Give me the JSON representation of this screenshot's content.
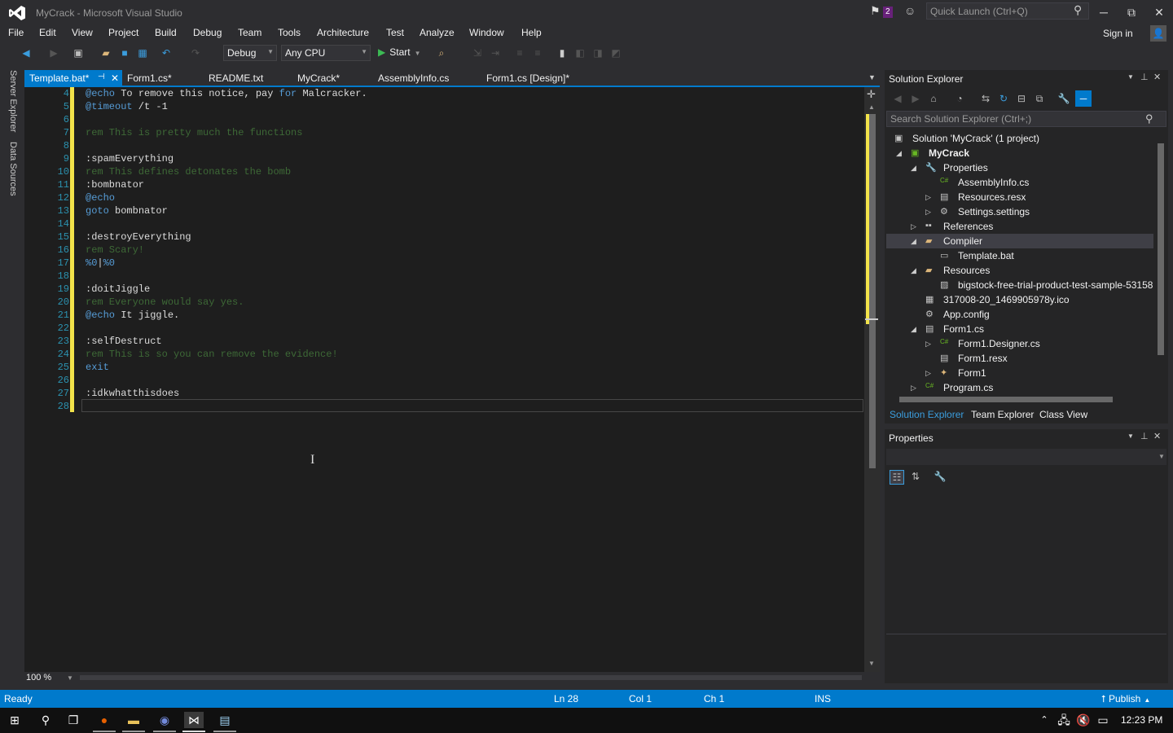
{
  "window": {
    "title": "MyCrack - Microsoft Visual Studio",
    "notification_count": "2",
    "quick_launch_placeholder": "Quick Launch (Ctrl+Q)",
    "minimize": "─",
    "restore": "⧉",
    "close": "✕"
  },
  "menu": [
    "File",
    "Edit",
    "View",
    "Project",
    "Build",
    "Debug",
    "Team",
    "Tools",
    "Architecture",
    "Test",
    "Analyze",
    "Window",
    "Help"
  ],
  "account": {
    "signin_label": "Sign in"
  },
  "toolbar": {
    "configuration": "Debug",
    "platform": "Any CPU",
    "start_label": "Start"
  },
  "left_strip": {
    "server_explorer": "Server Explorer",
    "data_sources": "Data Sources"
  },
  "tabs": [
    {
      "label": "Template.bat*",
      "active": true
    },
    {
      "label": "Form1.cs*"
    },
    {
      "label": "README.txt"
    },
    {
      "label": "MyCrack*"
    },
    {
      "label": "AssemblyInfo.cs"
    },
    {
      "label": "Form1.cs [Design]*"
    }
  ],
  "editor": {
    "lines": [
      {
        "n": "4",
        "parts": [
          [
            "kw",
            "@echo"
          ],
          [
            "t",
            " To remove this notice, pay "
          ],
          [
            "kw",
            "for"
          ],
          [
            "t",
            " Malcracker."
          ]
        ]
      },
      {
        "n": "5",
        "parts": [
          [
            "kw",
            "@timeout"
          ],
          [
            "t",
            " /t -1"
          ]
        ]
      },
      {
        "n": "6",
        "parts": []
      },
      {
        "n": "7",
        "parts": [
          [
            "cm",
            "rem This is pretty much the functions"
          ]
        ]
      },
      {
        "n": "8",
        "parts": []
      },
      {
        "n": "9",
        "parts": [
          [
            "t",
            ":spamEverything"
          ]
        ]
      },
      {
        "n": "10",
        "parts": [
          [
            "cm",
            "rem This defines detonates the bomb"
          ]
        ]
      },
      {
        "n": "11",
        "parts": [
          [
            "t",
            ":bombnator"
          ]
        ]
      },
      {
        "n": "12",
        "parts": [
          [
            "kw",
            "@echo"
          ]
        ]
      },
      {
        "n": "13",
        "parts": [
          [
            "kw",
            "goto"
          ],
          [
            "t",
            " bombnator"
          ]
        ]
      },
      {
        "n": "14",
        "parts": []
      },
      {
        "n": "15",
        "parts": [
          [
            "t",
            ":destroyEverything"
          ]
        ]
      },
      {
        "n": "16",
        "parts": [
          [
            "cm",
            "rem Scary!"
          ]
        ]
      },
      {
        "n": "17",
        "parts": [
          [
            "kw",
            "%0"
          ],
          [
            "t",
            "|"
          ],
          [
            "kw",
            "%0"
          ]
        ]
      },
      {
        "n": "18",
        "parts": []
      },
      {
        "n": "19",
        "parts": [
          [
            "t",
            ":doitJiggle"
          ]
        ]
      },
      {
        "n": "20",
        "parts": [
          [
            "cm",
            "rem Everyone would say yes."
          ]
        ]
      },
      {
        "n": "21",
        "parts": [
          [
            "kw",
            "@echo"
          ],
          [
            "t",
            " It jiggle."
          ]
        ]
      },
      {
        "n": "22",
        "parts": []
      },
      {
        "n": "23",
        "parts": [
          [
            "t",
            ":selfDestruct"
          ]
        ]
      },
      {
        "n": "24",
        "parts": [
          [
            "cm",
            "rem This is so you can remove the evidence!"
          ]
        ]
      },
      {
        "n": "25",
        "parts": [
          [
            "kw",
            "exit"
          ]
        ]
      },
      {
        "n": "26",
        "parts": []
      },
      {
        "n": "27",
        "parts": [
          [
            "t",
            ":idkwhatthisdoes"
          ]
        ]
      },
      {
        "n": "28",
        "parts": []
      }
    ],
    "zoom": "100 %"
  },
  "solution_explorer": {
    "title": "Solution Explorer",
    "search_placeholder": "Search Solution Explorer (Ctrl+;)",
    "tree": [
      {
        "label": "Solution 'MyCrack' (1 project)",
        "icon": "solution-icon",
        "level": 0
      },
      {
        "label": "MyCrack",
        "icon": "csharp-project-icon",
        "level": 0,
        "bold": true,
        "exp": "open"
      },
      {
        "label": "Properties",
        "icon": "wrench-icon",
        "level": 1,
        "exp": "open"
      },
      {
        "label": "AssemblyInfo.cs",
        "icon": "csharp-file-icon",
        "level": 2
      },
      {
        "label": "Resources.resx",
        "icon": "resx-icon",
        "level": 2,
        "exp": "closed"
      },
      {
        "label": "Settings.settings",
        "icon": "settings-icon",
        "level": 2,
        "exp": "closed"
      },
      {
        "label": "References",
        "icon": "references-icon",
        "level": 1,
        "exp": "closed"
      },
      {
        "label": "Compiler",
        "icon": "folder-open-icon",
        "level": 1,
        "exp": "open",
        "selected": true
      },
      {
        "label": "Template.bat",
        "icon": "file-icon",
        "level": 2
      },
      {
        "label": "Resources",
        "icon": "folder-open-icon",
        "level": 1,
        "exp": "open"
      },
      {
        "label": "bigstock-free-trial-product-test-sample-53158",
        "icon": "image-icon",
        "level": 2
      },
      {
        "label": "317008-20_1469905978y.ico",
        "icon": "ico-file-icon",
        "level": 1
      },
      {
        "label": "App.config",
        "icon": "config-icon",
        "level": 1
      },
      {
        "label": "Form1.cs",
        "icon": "form-icon",
        "level": 1,
        "exp": "open"
      },
      {
        "label": "Form1.Designer.cs",
        "icon": "csharp-file-icon",
        "level": 2,
        "exp": "closed"
      },
      {
        "label": "Form1.resx",
        "icon": "resx-icon",
        "level": 2
      },
      {
        "label": "Form1",
        "icon": "class-icon",
        "level": 2,
        "exp": "closed"
      },
      {
        "label": "Program.cs",
        "icon": "csharp-file-icon",
        "level": 1,
        "exp": "closed"
      }
    ],
    "bottom_tabs": [
      "Solution Explorer",
      "Team Explorer",
      "Class View"
    ]
  },
  "properties": {
    "title": "Properties"
  },
  "status": {
    "ready": "Ready",
    "line": "Ln 28",
    "col": "Col 1",
    "ch": "Ch 1",
    "ins": "INS",
    "publish": "Publish"
  },
  "taskbar": {
    "time": "12:23 PM"
  },
  "colors": {
    "accent": "#007acc",
    "editor_bg": "#1e1e1e",
    "chrome_bg": "#2d2d30",
    "keyword": "#569cd6",
    "comment": "#57a64a",
    "line_number": "#2b91af",
    "change_marker": "#f2e34a"
  }
}
